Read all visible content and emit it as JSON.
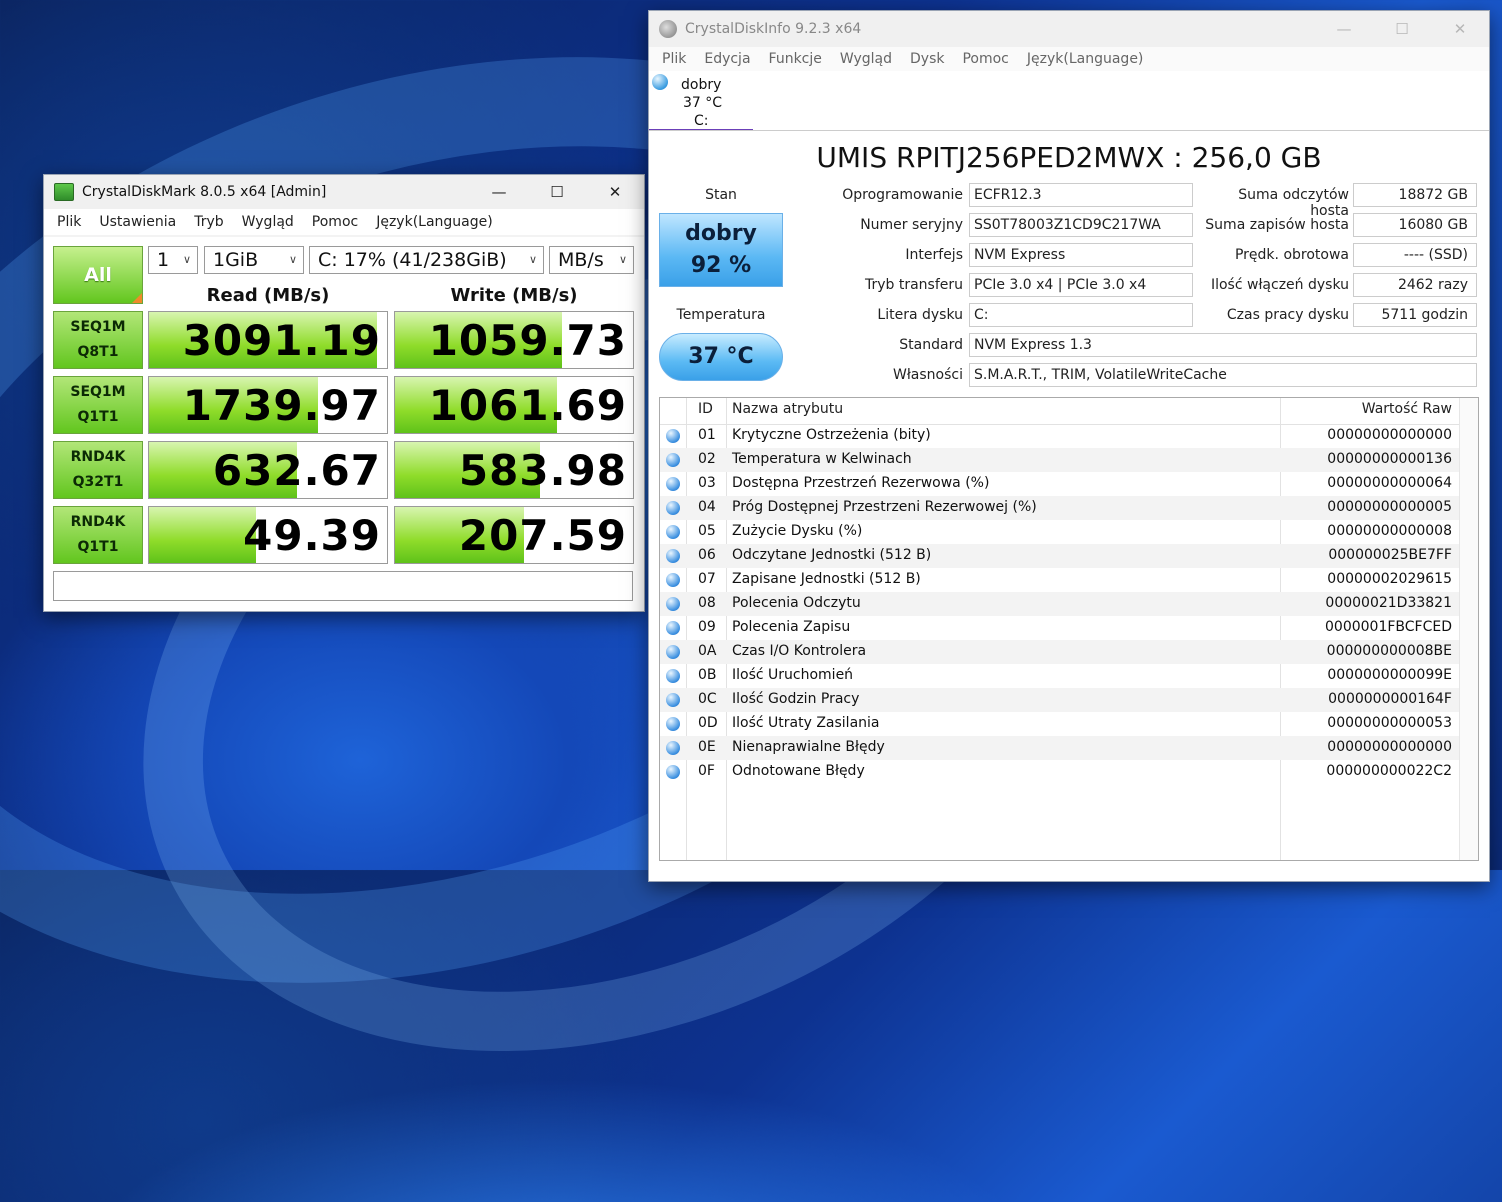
{
  "cdm": {
    "title": "CrystalDiskMark 8.0.5 x64 [Admin]",
    "menu": [
      "Plik",
      "Ustawienia",
      "Tryb",
      "Wygląd",
      "Pomoc",
      "Język(Language)"
    ],
    "all_button": "All",
    "count": "1",
    "size": "1GiB",
    "drive": "C: 17% (41/238GiB)",
    "unit": "MB/s",
    "read_header": "Read (MB/s)",
    "write_header": "Write (MB/s)",
    "tests": [
      {
        "l1": "SEQ1M",
        "l2": "Q8T1",
        "read": "3091.19",
        "write": "1059.73",
        "read_fill": 0.96,
        "write_fill": 0.7
      },
      {
        "l1": "SEQ1M",
        "l2": "Q1T1",
        "read": "1739.97",
        "write": "1061.69",
        "read_fill": 0.71,
        "write_fill": 0.68
      },
      {
        "l1": "RND4K",
        "l2": "Q32T1",
        "read": "632.67",
        "write": "583.98",
        "read_fill": 0.62,
        "write_fill": 0.61
      },
      {
        "l1": "RND4K",
        "l2": "Q1T1",
        "read": "49.39",
        "write": "207.59",
        "read_fill": 0.45,
        "write_fill": 0.54
      }
    ],
    "status": ""
  },
  "cdi": {
    "title": "CrystalDiskInfo 9.2.3 x64",
    "menu": [
      "Plik",
      "Edycja",
      "Funkcje",
      "Wygląd",
      "Dysk",
      "Pomoc",
      "Język(Language)"
    ],
    "tab": {
      "health": "dobry",
      "temp": "37 °C",
      "drive": "C:"
    },
    "model": "UMIS RPITJ256PED2MWX : 256,0 GB",
    "stan_label": "Stan",
    "health_text": "dobry",
    "health_pct": "92 %",
    "temp_label": "Temperatura",
    "temp_value": "37 °C",
    "info_left": [
      {
        "label": "Oprogramowanie",
        "value": "ECFR12.3"
      },
      {
        "label": "Numer seryjny",
        "value": "SS0T78003Z1CD9C217WA"
      },
      {
        "label": "Interfejs",
        "value": "NVM Express"
      },
      {
        "label": "Tryb transferu",
        "value": "PCIe 3.0 x4 | PCIe 3.0 x4"
      },
      {
        "label": "Litera dysku",
        "value": "C:"
      },
      {
        "label": "Standard",
        "value": "NVM Express 1.3"
      },
      {
        "label": "Własności",
        "value": "S.M.A.R.T., TRIM, VolatileWriteCache"
      }
    ],
    "info_right": [
      {
        "label": "Suma odczytów hosta",
        "value": "18872 GB"
      },
      {
        "label": "Suma zapisów hosta",
        "value": "16080 GB"
      },
      {
        "label": "Prędk. obrotowa",
        "value": "---- (SSD)"
      },
      {
        "label": "Ilość włączeń dysku",
        "value": "2462 razy"
      },
      {
        "label": "Czas pracy dysku",
        "value": "5711 godzin"
      }
    ],
    "table_headers": {
      "id": "ID",
      "name": "Nazwa atrybutu",
      "raw": "Wartość Raw"
    },
    "attributes": [
      {
        "id": "01",
        "name": "Krytyczne Ostrzeżenia (bity)",
        "raw": "00000000000000"
      },
      {
        "id": "02",
        "name": "Temperatura w Kelwinach",
        "raw": "00000000000136"
      },
      {
        "id": "03",
        "name": "Dostępna Przestrzeń Rezerwowa (%)",
        "raw": "00000000000064"
      },
      {
        "id": "04",
        "name": "Próg Dostępnej Przestrzeni Rezerwowej (%)",
        "raw": "00000000000005"
      },
      {
        "id": "05",
        "name": "Zużycie Dysku (%)",
        "raw": "00000000000008"
      },
      {
        "id": "06",
        "name": "Odczytane Jednostki (512 B)",
        "raw": "000000025BE7FF"
      },
      {
        "id": "07",
        "name": "Zapisane Jednostki (512 B)",
        "raw": "00000002029615"
      },
      {
        "id": "08",
        "name": "Polecenia Odczytu",
        "raw": "00000021D33821"
      },
      {
        "id": "09",
        "name": "Polecenia Zapisu",
        "raw": "0000001FBCFCED"
      },
      {
        "id": "0A",
        "name": "Czas I/O Kontrolera",
        "raw": "000000000008BE"
      },
      {
        "id": "0B",
        "name": "Ilość Uruchomień",
        "raw": "0000000000099E"
      },
      {
        "id": "0C",
        "name": "Ilość Godzin Pracy",
        "raw": "0000000000164F"
      },
      {
        "id": "0D",
        "name": "Ilość Utraty Zasilania",
        "raw": "00000000000053"
      },
      {
        "id": "0E",
        "name": "Nienaprawialne Błędy",
        "raw": "00000000000000"
      },
      {
        "id": "0F",
        "name": "Odnotowane Błędy",
        "raw": "000000000022C2"
      }
    ]
  }
}
